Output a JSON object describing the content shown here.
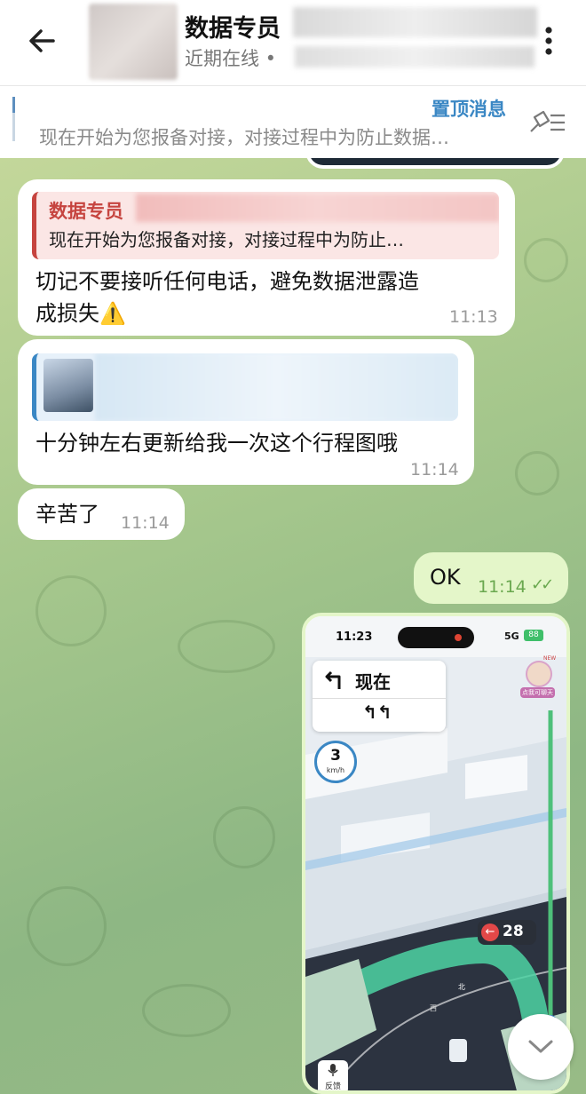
{
  "header": {
    "title": "数据专员",
    "subtitle": "近期在线 •",
    "back_icon": "arrow-left-icon",
    "menu_icon": "more-vertical-icon"
  },
  "pinned": {
    "title": "置顶消息",
    "text": "现在开始为您报备对接，对接过程中为防止数据…"
  },
  "messages": [
    {
      "quote_author": "数据专员",
      "quote_text": "现在开始为您报备对接，对接过程中为防止…",
      "text_line1": "切记不要接听任何电话，避免数据泄露造",
      "text_line2": "成损失",
      "emoji": "⚠️",
      "time": "11:13"
    },
    {
      "text": "十分钟左右更新给我一次这个行程图哦",
      "time": "11:14"
    },
    {
      "text": "辛苦了",
      "time": "11:14"
    },
    {
      "text": "OK",
      "time": "11:14",
      "status": "✓✓"
    }
  ],
  "nav_screenshot": {
    "status_time": "11:23",
    "status_net": "5G",
    "status_battery": "88",
    "direction_label": "现在",
    "lanes": "↰↰",
    "speed": "3",
    "speed_unit": "km/h",
    "turn_distance": "28",
    "feedback_label": "反馈",
    "avatar_label": "点我可聊天",
    "avatar_badge": "NEW",
    "map_dir_west": "西",
    "map_dir_north": "北"
  },
  "colors": {
    "accent": "#3a87c4",
    "quote_author": "#c6443f",
    "outgoing_bubble": "#e4f6c9",
    "route_green": "#4ed3a3"
  }
}
